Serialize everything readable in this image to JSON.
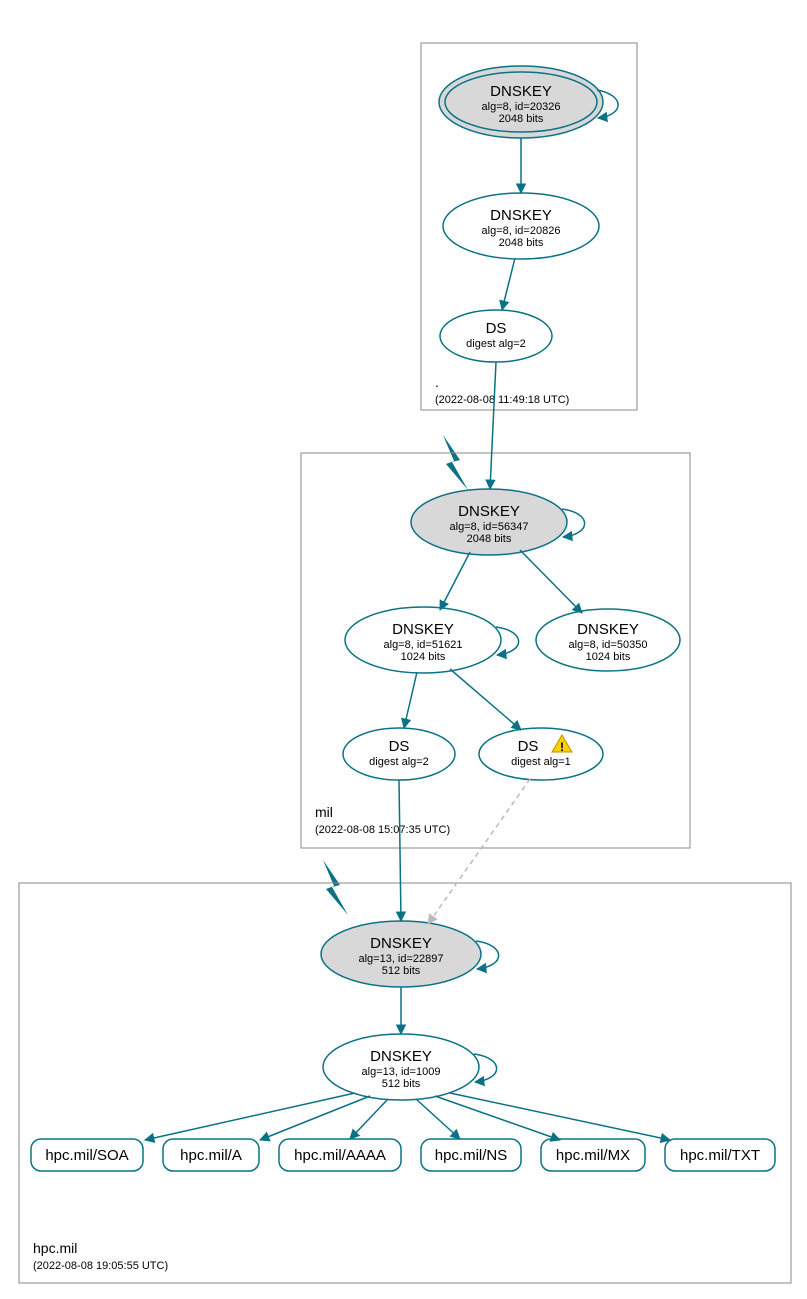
{
  "zones": {
    "root": {
      "label": ".",
      "timestamp": "(2022-08-08 11:49:18 UTC)"
    },
    "mil": {
      "label": "mil",
      "timestamp": "(2022-08-08 15:07:35 UTC)"
    },
    "hpc": {
      "label": "hpc.mil",
      "timestamp": "(2022-08-08 19:05:55 UTC)"
    }
  },
  "nodes": {
    "root_ksk": {
      "title": "DNSKEY",
      "line1": "alg=8, id=20326",
      "line2": "2048 bits"
    },
    "root_zsk": {
      "title": "DNSKEY",
      "line1": "alg=8, id=20826",
      "line2": "2048 bits"
    },
    "root_ds": {
      "title": "DS",
      "line1": "digest alg=2",
      "line2": ""
    },
    "mil_ksk": {
      "title": "DNSKEY",
      "line1": "alg=8, id=56347",
      "line2": "2048 bits"
    },
    "mil_zsk1": {
      "title": "DNSKEY",
      "line1": "alg=8, id=51621",
      "line2": "1024 bits"
    },
    "mil_zsk2": {
      "title": "DNSKEY",
      "line1": "alg=8, id=50350",
      "line2": "1024 bits"
    },
    "mil_ds1": {
      "title": "DS",
      "line1": "digest alg=2",
      "line2": ""
    },
    "mil_ds2": {
      "title": "DS",
      "line1": "digest alg=1",
      "line2": ""
    },
    "hpc_ksk": {
      "title": "DNSKEY",
      "line1": "alg=13, id=22897",
      "line2": "512 bits"
    },
    "hpc_zsk": {
      "title": "DNSKEY",
      "line1": "alg=13, id=1009",
      "line2": "512 bits"
    }
  },
  "records": {
    "soa": "hpc.mil/SOA",
    "a": "hpc.mil/A",
    "aaaa": "hpc.mil/AAAA",
    "ns": "hpc.mil/NS",
    "mx": "hpc.mil/MX",
    "txt": "hpc.mil/TXT"
  }
}
